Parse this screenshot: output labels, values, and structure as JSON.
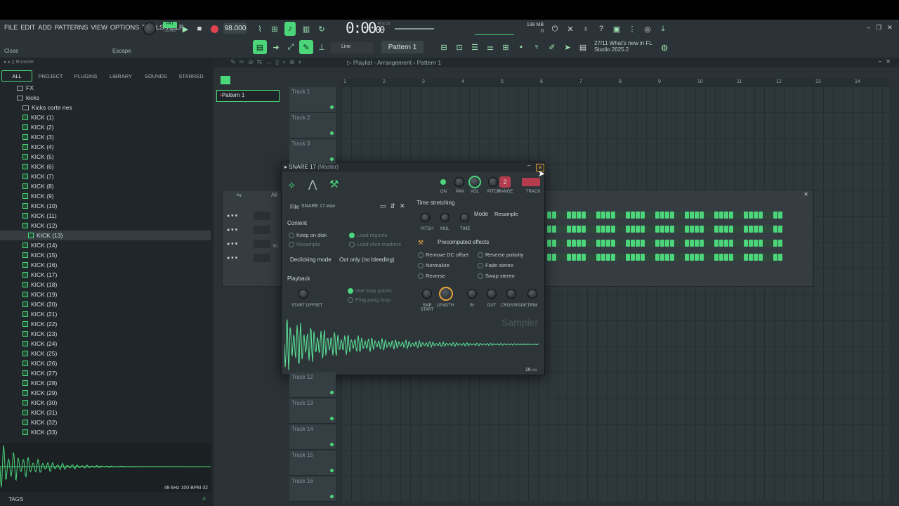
{
  "menu": [
    "FILE",
    "EDIT",
    "ADD",
    "PATTERNS",
    "VIEW",
    "OPTIONS",
    "TOOLS",
    "HELP"
  ],
  "hint": {
    "left": "Close",
    "right": "Escape"
  },
  "transport": {
    "pat_label": "PAT",
    "song_label": "SONG",
    "tempo": "98.000",
    "time": "0:00",
    "time_sub": "00",
    "time_unit": "M:S:CS"
  },
  "memory": {
    "ram": "138 MB",
    "cpu": "0"
  },
  "snap": {
    "mode": "Line"
  },
  "pattern_selector": "Pattern 1",
  "news": {
    "date": "27/11",
    "text": "What's new in FL Studio 2025.2"
  },
  "browser": {
    "title": "Browser",
    "tabs": [
      "ALL",
      "PROJECT",
      "PLUGINS",
      "LIBRARY",
      "SOUNDS",
      "STARRED"
    ],
    "tree": [
      {
        "label": "FX",
        "type": "folder",
        "indent": 24
      },
      {
        "label": "kicks",
        "type": "folder",
        "indent": 24
      },
      {
        "label": "Kicks corte nes",
        "type": "folder",
        "indent": 32
      },
      {
        "label": "KICK (1)",
        "type": "file"
      },
      {
        "label": "KICK (2)",
        "type": "file"
      },
      {
        "label": "KICK (3)",
        "type": "file"
      },
      {
        "label": "KICK (4)",
        "type": "file"
      },
      {
        "label": "KICK (5)",
        "type": "file"
      },
      {
        "label": "KICK (6)",
        "type": "file"
      },
      {
        "label": "KICK (7)",
        "type": "file"
      },
      {
        "label": "KICK (8)",
        "type": "file"
      },
      {
        "label": "KICK (9)",
        "type": "file"
      },
      {
        "label": "KICK (10)",
        "type": "file"
      },
      {
        "label": "KICK (11)",
        "type": "file"
      },
      {
        "label": "KICK (12)",
        "type": "file"
      },
      {
        "label": "KICK (13)",
        "type": "file",
        "selected": true
      },
      {
        "label": "KICK (14)",
        "type": "file"
      },
      {
        "label": "KICK (15)",
        "type": "file"
      },
      {
        "label": "KICK (16)",
        "type": "file"
      },
      {
        "label": "KICK (17)",
        "type": "file"
      },
      {
        "label": "KICK (18)",
        "type": "file"
      },
      {
        "label": "KICK (19)",
        "type": "file"
      },
      {
        "label": "KICK (20)",
        "type": "file"
      },
      {
        "label": "KICK (21)",
        "type": "file"
      },
      {
        "label": "KICK (22)",
        "type": "file"
      },
      {
        "label": "KICK (23)",
        "type": "file"
      },
      {
        "label": "KICK (24)",
        "type": "file"
      },
      {
        "label": "KICK (25)",
        "type": "file"
      },
      {
        "label": "KICK (26)",
        "type": "file"
      },
      {
        "label": "KICK (27)",
        "type": "file"
      },
      {
        "label": "KICK (28)",
        "type": "file"
      },
      {
        "label": "KICK (29)",
        "type": "file"
      },
      {
        "label": "KICK (30)",
        "type": "file"
      },
      {
        "label": "KICK (31)",
        "type": "file"
      },
      {
        "label": "KICK (32)",
        "type": "file"
      },
      {
        "label": "KICK (33)",
        "type": "file"
      }
    ],
    "preview_info": "48 kHz 100 BPM 32",
    "tags": "TAGS"
  },
  "playlist": {
    "title": "Playlist - Arrangement",
    "pattern": "Pattern 1",
    "pattern_clip": "Pattern 1",
    "ruler": [
      "1",
      "2",
      "3",
      "4",
      "5",
      "6",
      "7",
      "8",
      "9",
      "10",
      "11",
      "12",
      "13",
      "14"
    ],
    "tracks_top": [
      "Track 1",
      "Track 2",
      "Track 3"
    ],
    "tracks_bottom": [
      "Track 12",
      "Track 13",
      "Track 14",
      "Track 15",
      "Track 16"
    ]
  },
  "rack": {
    "filter": "All",
    "channel_partial": "Ki"
  },
  "sampler": {
    "title": "SNARE 17",
    "bus": "(Master)",
    "knob_labels": [
      "ON",
      "PAN",
      "VOL",
      "PITCH",
      "RANGE",
      "TRACK"
    ],
    "range_value": "2",
    "file_label": "File",
    "file_name": "SNARE 17.wav",
    "content_title": "Content",
    "content_opts": [
      {
        "label": "Keep on disk",
        "on": false,
        "dim": false
      },
      {
        "label": "Resample",
        "on": false,
        "dim": true
      }
    ],
    "content_opts2": [
      {
        "label": "Load regions",
        "on": true,
        "dim": true
      },
      {
        "label": "Load slice markers",
        "on": false,
        "dim": true
      }
    ],
    "declick_label": "Declicking mode",
    "declick_value": "Out only (no bleeding)",
    "playback_title": "Playback",
    "playback_opts": [
      {
        "label": "Use loop points",
        "on": true,
        "dim": true
      },
      {
        "label": "Ping pong loop",
        "on": false,
        "dim": true
      }
    ],
    "start_offset": "START OFFSET",
    "ts_title": "Time stretching",
    "ts_knobs": [
      "PITCH",
      "MUL",
      "TIME"
    ],
    "mode_label": "Mode",
    "mode_value": "Resample",
    "precomputed": "Precomputed effects",
    "effects_left": [
      "Remove DC offset",
      "Normalize",
      "Reverse"
    ],
    "effects_right": [
      "Reverse polarity",
      "Fade stereo",
      "Swap stereo"
    ],
    "env_knobs": [
      "SMP START",
      "LENGTH",
      "IN",
      "OUT",
      "CROSSFADE",
      "TRIM"
    ],
    "watermark": "Sampler",
    "bits": "16"
  },
  "colors": {
    "accent": "#4bd67a",
    "record": "#e0434f",
    "bg": "#2b3338"
  }
}
